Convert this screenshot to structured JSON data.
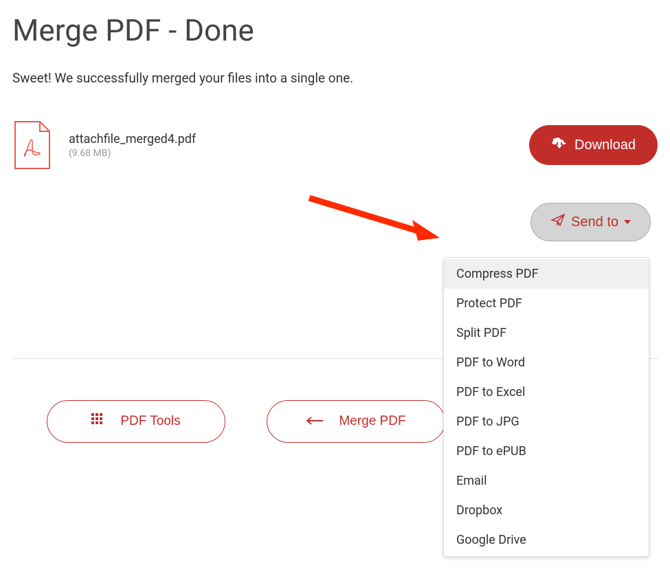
{
  "header": {
    "title": "Merge PDF - Done"
  },
  "message": "Sweet! We successfully merged your files into a single one.",
  "file": {
    "name": "attachfile_merged4.pdf",
    "size": "(9.68 MB)"
  },
  "buttons": {
    "download": "Download",
    "send_to": "Send to",
    "pdf_tools": "PDF Tools",
    "merge_pdf": "Merge PDF"
  },
  "dropdown": {
    "items": [
      {
        "label": "Compress PDF"
      },
      {
        "label": "Protect PDF"
      },
      {
        "label": "Split PDF"
      },
      {
        "label": "PDF to Word"
      },
      {
        "label": "PDF to Excel"
      },
      {
        "label": "PDF to JPG"
      },
      {
        "label": "PDF to ePUB"
      },
      {
        "label": "Email"
      },
      {
        "label": "Dropbox"
      },
      {
        "label": "Google Drive"
      }
    ]
  }
}
